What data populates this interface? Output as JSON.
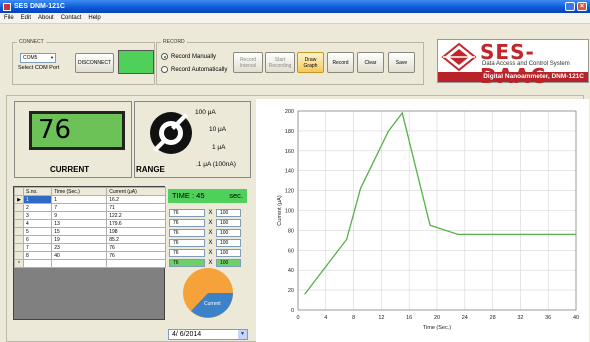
{
  "window": {
    "title": "SES DNM-121C"
  },
  "menu": [
    "File",
    "Edit",
    "About",
    "Contact",
    "Help"
  ],
  "connect": {
    "group_title": "CONNECT",
    "port_value": "COM5",
    "port_label": "Select COM Port",
    "disconnect_label": "DISCONNECT",
    "indicator_color": "#4fd05a"
  },
  "record": {
    "group_title": "RECORD",
    "manual_label": "Record Manually",
    "auto_label": "Record Automatically",
    "selected": "manual",
    "interval_label": "Record Interval",
    "start_label": "Start Recording",
    "draw_label": "Draw Graph",
    "record_label": "Record",
    "clear_label": "Clear",
    "save_label": "Save"
  },
  "logo": {
    "name": "SES-DAAC",
    "subtitle": "Data Access and Control System",
    "product": "Digital Nanoammeter, DNM-121C"
  },
  "display": {
    "value": "76",
    "current_label": "CURRENT",
    "range_label": "RANGE"
  },
  "ranges": [
    "100 μA",
    "10 μA",
    "1 μA",
    ".1 μA (100nA)"
  ],
  "table": {
    "headers": [
      "S.no.",
      "Time (Sec.)",
      "Current (μA)"
    ],
    "rows": [
      [
        "1",
        "1",
        "16.2"
      ],
      [
        "2",
        "7",
        "71"
      ],
      [
        "3",
        "9",
        "122.2"
      ],
      [
        "4",
        "13",
        "179.6"
      ],
      [
        "5",
        "15",
        "198"
      ],
      [
        "6",
        "19",
        "85.2"
      ],
      [
        "7",
        "23",
        "76"
      ],
      [
        "8",
        "40",
        "76"
      ]
    ]
  },
  "timer": {
    "label": "TIME : 45",
    "unit": "sec."
  },
  "values": [
    {
      "left": "76",
      "op": "X",
      "right": "100"
    },
    {
      "left": "76",
      "op": "X",
      "right": "100"
    },
    {
      "left": "76",
      "op": "X",
      "right": "100"
    },
    {
      "left": "76",
      "op": "X",
      "right": "100"
    },
    {
      "left": "76",
      "op": "X",
      "right": "100"
    },
    {
      "left": "76",
      "op": "X",
      "right": "100"
    }
  ],
  "pie": {
    "label": "Current",
    "orange": "#f5a23b",
    "blue": "#3b82c9"
  },
  "date": "4/ 6/2014",
  "chart_data": {
    "type": "line",
    "x": [
      1,
      7,
      9,
      13,
      15,
      19,
      23,
      40
    ],
    "y": [
      16.2,
      71,
      122.2,
      179.6,
      198,
      85.2,
      76,
      76
    ],
    "xlabel": "Time (Sec.)",
    "ylabel": "Current (μA)",
    "xlim": [
      0,
      40
    ],
    "ylim": [
      0,
      200
    ],
    "xticks": [
      0,
      4,
      8,
      12,
      16,
      20,
      24,
      28,
      32,
      36,
      40
    ],
    "yticks": [
      0,
      20,
      40,
      60,
      80,
      100,
      120,
      140,
      160,
      180,
      200
    ],
    "grid": true,
    "color": "#58b04a"
  }
}
